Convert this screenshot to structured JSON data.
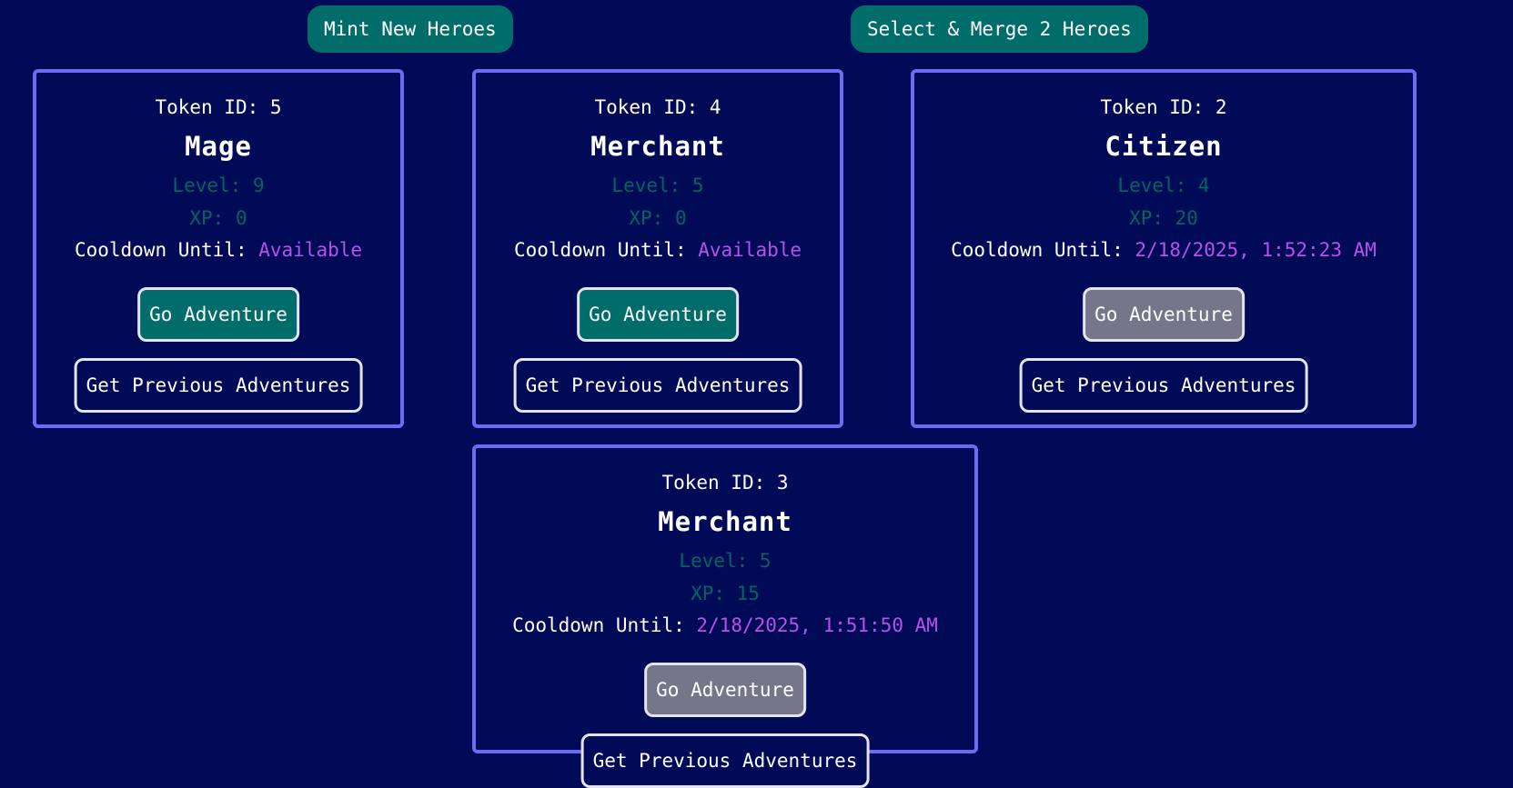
{
  "toolbar": {
    "mint_label": "Mint New Heroes",
    "merge_label": "Select & Merge 2 Heroes"
  },
  "colors": {
    "background": "#000a56",
    "card_border": "#6c6cf2",
    "teal_accent": "#006d6b",
    "cooldown_value": "#b950e8",
    "disabled_button": "#737789"
  },
  "cooldown_label": "Cooldown Until:",
  "heroes": [
    {
      "token": "Token ID: 5",
      "name": "Mage",
      "level": "Level: 9",
      "xp": "XP: 0",
      "cooldown": "Available",
      "adventure_label": "Go Adventure",
      "adventure_available": true,
      "previous_label": "Get Previous Adventures"
    },
    {
      "token": "Token ID: 4",
      "name": "Merchant",
      "level": "Level: 5",
      "xp": "XP: 0",
      "cooldown": "Available",
      "adventure_label": "Go Adventure",
      "adventure_available": true,
      "previous_label": "Get Previous Adventures"
    },
    {
      "token": "Token ID: 2",
      "name": "Citizen",
      "level": "Level: 4",
      "xp": "XP: 20",
      "cooldown": "2/18/2025, 1:52:23 AM",
      "adventure_label": "Go Adventure",
      "adventure_available": false,
      "previous_label": "Get Previous Adventures"
    },
    {
      "token": "Token ID: 3",
      "name": "Merchant",
      "level": "Level: 5",
      "xp": "XP: 15",
      "cooldown": "2/18/2025, 1:51:50 AM",
      "adventure_label": "Go Adventure",
      "adventure_available": false,
      "previous_label": "Get Previous Adventures"
    }
  ]
}
